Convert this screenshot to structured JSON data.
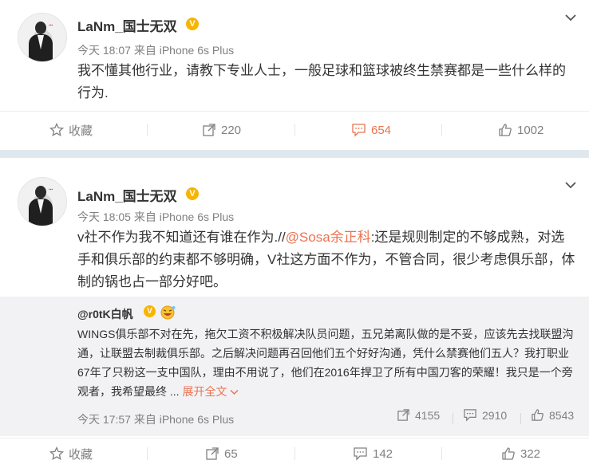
{
  "posts": [
    {
      "username": "LaNm_国士无双",
      "verified_badge": "V",
      "timestamp": "今天 18:07",
      "source_prefix": "来自",
      "device": "iPhone 6s Plus",
      "text": "我不懂其他行业，请教下专业人士，一般足球和篮球被终生禁赛都是一些什么样的行为.",
      "actions": {
        "favorite_label": "收藏",
        "repost_count": "220",
        "comment_count": "654",
        "like_count": "1002"
      },
      "comments_highlighted": true
    },
    {
      "username": "LaNm_国士无双",
      "verified_badge": "V",
      "timestamp": "今天 18:05",
      "source_prefix": "来自",
      "device": "iPhone 6s Plus",
      "text_before": "v社不作为我不知道还有谁在作为.//",
      "mention": "@Sosa余正科",
      "text_after": ":还是规则制定的不够成熟，对选手和俱乐部的约束都不够明确，V社这方面不作为，不管合同，很少考虑俱乐部，体制的锅也占一部分好吧。",
      "repost": {
        "username": "@r0tK白帆",
        "verified_badge": "V",
        "text": "WINGS俱乐部不对在先，拖欠工资不积极解决队员问题，五兄弟离队做的是不妥，应该先去找联盟沟通，让联盟去制裁俱乐部。之后解决问题再召回他们五个好好沟通，凭什么禁赛他们五人？我打职业67年了只粉这一支中国队，理由不用说了，他们在2016年捍卫了所有中国刀客的荣耀！我只是一个旁观者，我希望最终 ...",
        "expand_label": "展开全文",
        "timestamp": "今天 17:57",
        "source_prefix": "来自",
        "device": "iPhone 6s Plus",
        "repost_count": "4155",
        "comment_count": "2910",
        "like_count": "8543"
      },
      "actions": {
        "favorite_label": "收藏",
        "repost_count": "65",
        "comment_count": "142",
        "like_count": "322"
      }
    }
  ],
  "colors": {
    "accent": "#eb7350",
    "verified": "#f7b500",
    "muted": "#808080",
    "page_bg": "#eaeef2",
    "repost_bg": "#f2f2f5"
  }
}
